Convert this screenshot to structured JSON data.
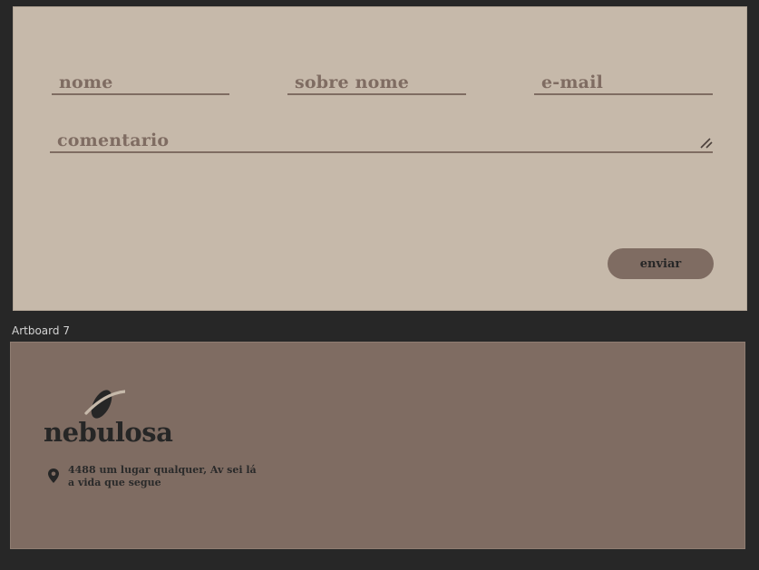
{
  "form": {
    "name_label": "nome",
    "surname_label": "sobre nome",
    "email_label": "e-mail",
    "comment_label": "comentario",
    "submit_label": "enviar"
  },
  "artboard": {
    "label": "Artboard 7"
  },
  "footer": {
    "brand_name": "nebulosa",
    "address_line1": "4488 um lugar qualquer, Av sei lá",
    "address_line2": "a vida que segue"
  },
  "colors": {
    "canvas": "#272727",
    "form_bg": "#c6b9aa",
    "accent": "#7f6c62",
    "text_dark": "#262626"
  }
}
